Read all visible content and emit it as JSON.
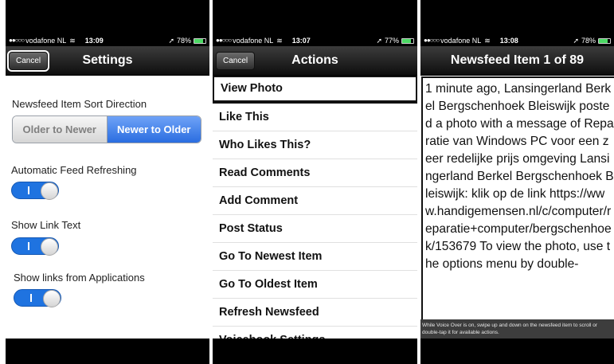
{
  "settings": {
    "status": {
      "carrier": "vodafone NL",
      "time": "13:09",
      "battery": "78%"
    },
    "title": "Settings",
    "cancel": "Cancel",
    "sort_label": "Newsfeed Item Sort Direction",
    "sort_options": [
      "Older to Newer",
      "Newer to Older"
    ],
    "sort_selected": "Newer to Older",
    "refresh_label": "Automatic Feed Refreshing",
    "link_text_label": "Show Link Text",
    "app_links_label": "Show links from Applications",
    "toggles_on": [
      true,
      true,
      true
    ]
  },
  "actions": {
    "status": {
      "carrier": "vodafone NL",
      "time": "13:07",
      "battery": "77%"
    },
    "title": "Actions",
    "cancel": "Cancel",
    "items": [
      "View Photo",
      "Like This",
      "Who Likes This?",
      "Read Comments",
      "Add Comment",
      "Post Status",
      "Go To Newest Item",
      "Go To Oldest Item",
      "Refresh Newsfeed",
      "Voicebook Settings"
    ],
    "selected": "View Photo"
  },
  "newsfeed": {
    "status": {
      "carrier": "vodafone NL",
      "time": "13:08",
      "battery": "78%"
    },
    "title": "Newsfeed Item 1 of 89",
    "body": "1 minute ago, Lansingerland Berkel Bergschenhoek Bleiswijk posted a photo with a message of Reparatie van Windows PC voor een zeer redelijke prijs omgeving Lansingerland Berkel Bergschenhoek Bleiswijk:  klik op de link https://www.handigemensen.nl/c/computer/reparatie+computer/bergschenhoek/153679 To view the photo, use the options menu by double-",
    "hint": "While Voice Over is on, swipe up and down on the newsfeed item to scroll or double-tap it for available actions."
  },
  "colors": {
    "accent": "#2a6de0",
    "toggle_on": "#1f73e0",
    "battery_green": "#4cd964"
  }
}
